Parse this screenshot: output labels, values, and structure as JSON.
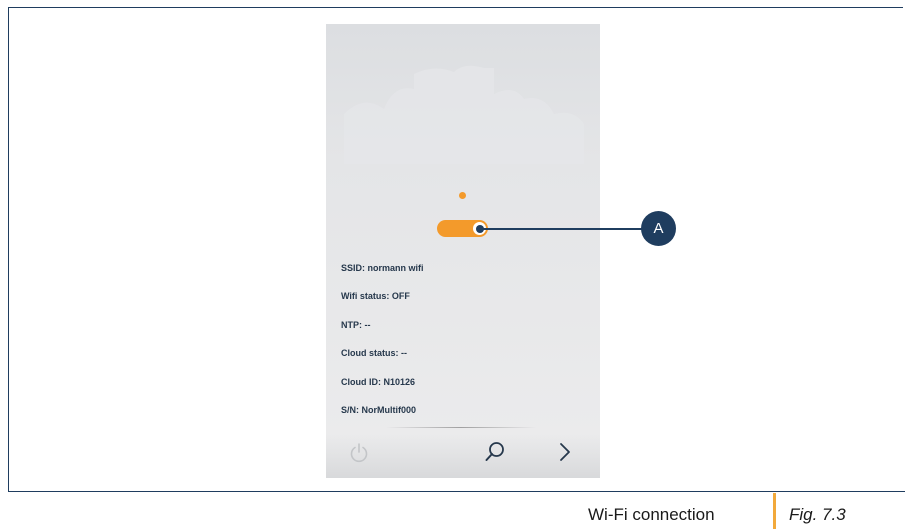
{
  "device": {
    "toggle": {
      "state": "on",
      "color": "#f39a2b"
    },
    "info": [
      {
        "label": "SSID: normann wifi"
      },
      {
        "label": "Wifi status: OFF"
      },
      {
        "label": "NTP: --"
      },
      {
        "label": "Cloud status: --"
      },
      {
        "label": "Cloud ID: N10126"
      },
      {
        "label": "S/N: NorMultif000"
      }
    ],
    "nav": {
      "power_icon": "power-icon",
      "search_icon": "search-icon",
      "next_icon": "chevron-right-icon"
    }
  },
  "callout": {
    "label": "A",
    "color": "#1f3d5f"
  },
  "caption": {
    "text": "Wi-Fi connection",
    "figure": "Fig. 7.3",
    "separator_color": "#f2a93b"
  }
}
